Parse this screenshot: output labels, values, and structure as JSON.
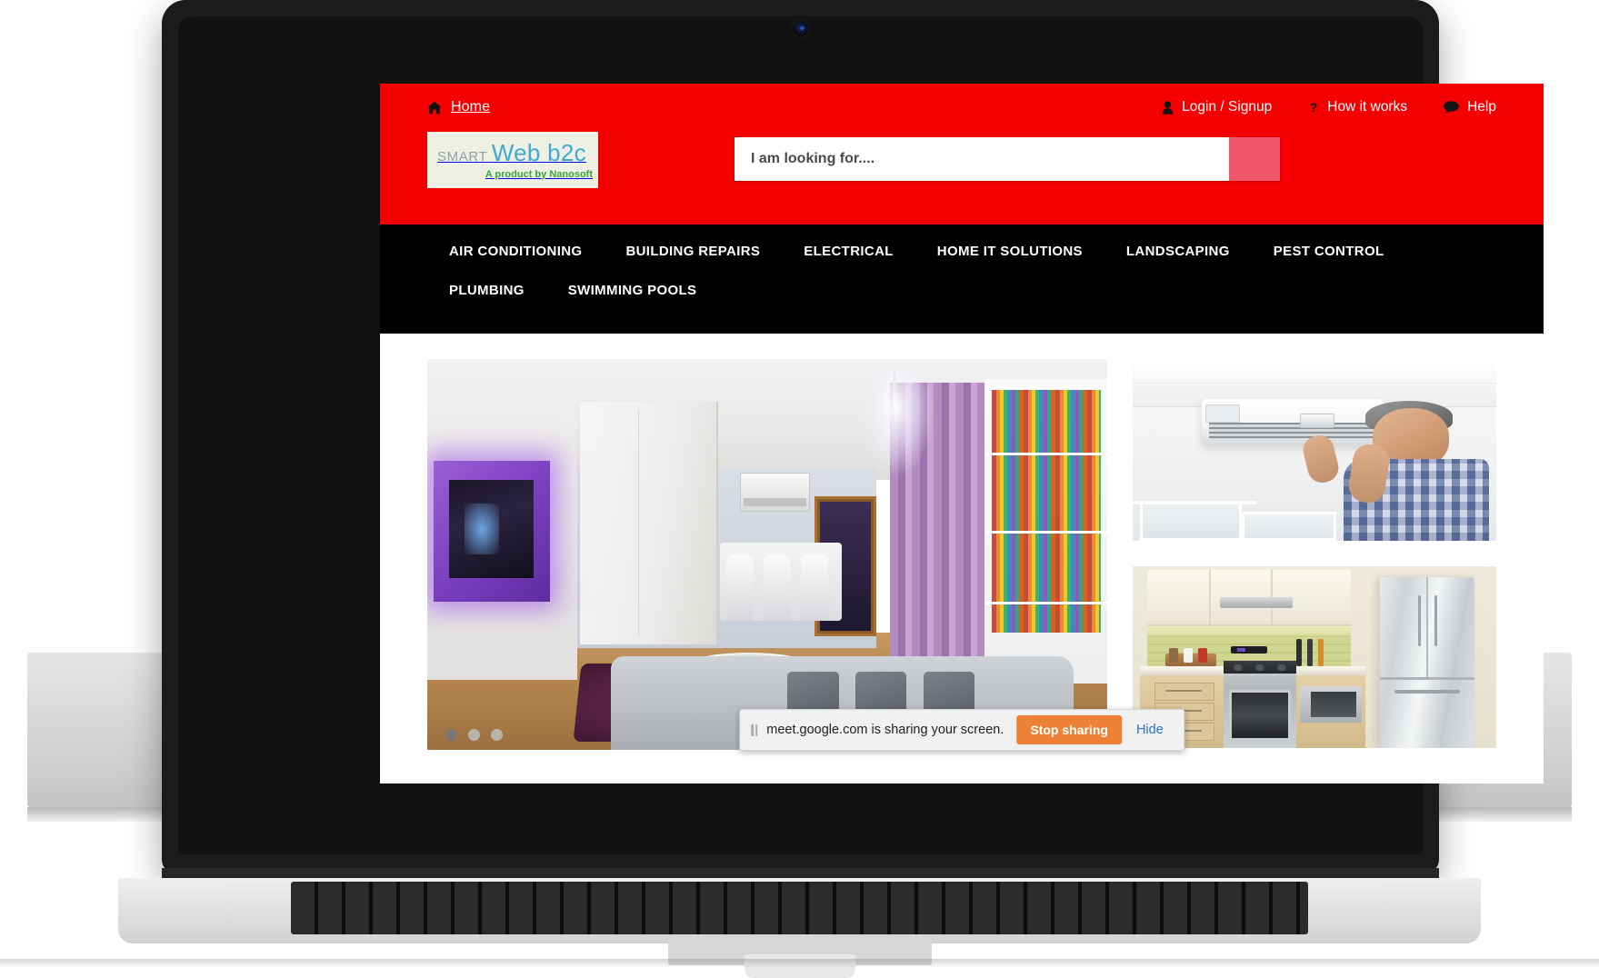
{
  "browser_notification": {
    "pause_icon": "pause-icon",
    "message": "meet.google.com is sharing your screen.",
    "stop_label": "Stop sharing",
    "hide_label": "Hide"
  },
  "site": {
    "colors": {
      "header_red": "#f50000",
      "nav_black": "#000000",
      "search_button": "#f0566b",
      "logo_bg": "#eef0e4",
      "logo_web_blue": "#3fa9d1",
      "logo_smart_gray": "#8fa0ad",
      "logo_tagline_green": "#3aa53a",
      "share_orange": "#ef8137",
      "hide_blue": "#2a6fc9"
    },
    "topbar": {
      "home": {
        "label": "Home",
        "icon": "home-icon"
      },
      "links": [
        {
          "label": "Login / Signup",
          "icon": "user-icon"
        },
        {
          "label": "How it works",
          "icon": "question-mark-icon"
        },
        {
          "label": "Help",
          "icon": "speech-bubble-icon"
        }
      ]
    },
    "logo": {
      "smart": "SMART",
      "web": "Web b2c",
      "tagline": "A product by Nanosoft"
    },
    "search": {
      "placeholder": "I am looking for....",
      "value": "",
      "button_icon": "search-icon"
    },
    "nav": [
      {
        "label": "AIR CONDITIONING"
      },
      {
        "label": "BUILDING REPAIRS"
      },
      {
        "label": "ELECTRICAL"
      },
      {
        "label": "HOME IT SOLUTIONS"
      },
      {
        "label": "LANDSCAPING"
      },
      {
        "label": "PEST CONTROL"
      },
      {
        "label": "PLUMBING"
      },
      {
        "label": "SWIMMING POOLS"
      }
    ],
    "hero": {
      "alt": "Modern living room with purple LED backlit TV wall, chandelier, white sofa and bookshelves",
      "slide_count": 3,
      "active_slide": 1
    },
    "thumbnails": [
      {
        "alt": "Technician servicing a wall-mounted split air conditioner unit"
      },
      {
        "alt": "Modern kitchen with stainless steel refrigerator, gas range and microwave"
      }
    ]
  },
  "device": {
    "type": "laptop-mockup",
    "webcam": "webcam-icon"
  }
}
